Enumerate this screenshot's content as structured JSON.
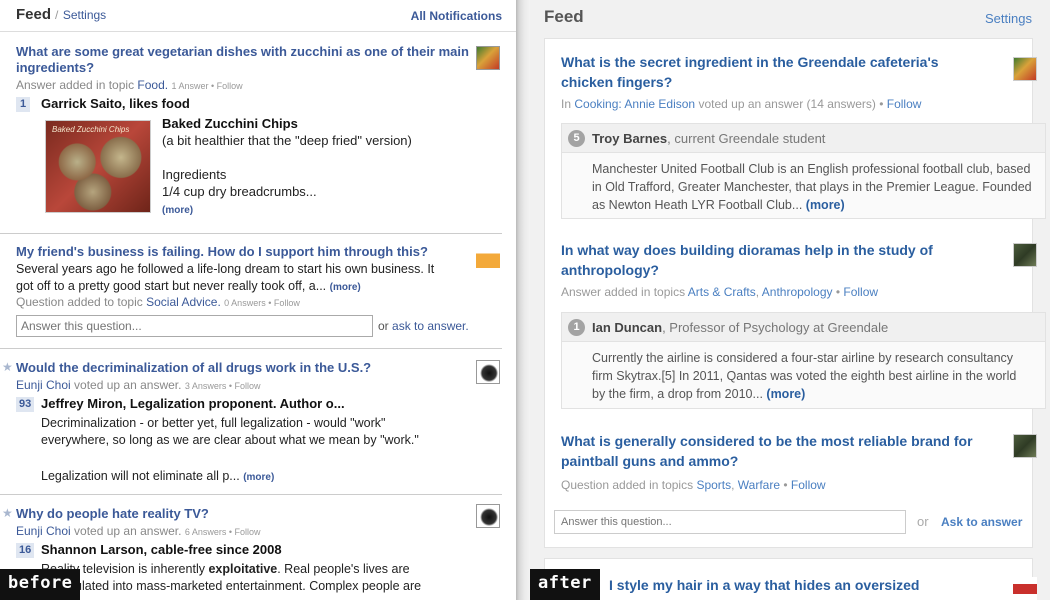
{
  "before": {
    "label": "before",
    "header": {
      "title": "Feed",
      "slash": "/",
      "settings": "Settings",
      "all_notifications": "All Notifications"
    },
    "items": [
      {
        "question": "What are some great vegetarian dishes with zucchini as one of their main ingredients?",
        "meta_prefix": "Answer added in topic",
        "topic": "Food.",
        "meta_small": "1 Answer • Follow",
        "count": "1",
        "answerer": "Garrick Saito, likes food",
        "image_caption": "Baked Zucchini Chips",
        "answer_title": "Baked Zucchini Chips",
        "answer_lines": [
          "(a bit healthier that the \"deep fried\" version)",
          "",
          "Ingredients",
          "1/4 cup dry breadcrumbs..."
        ],
        "more": "(more)"
      },
      {
        "question": "My friend's business is failing. How do I support him through this?",
        "body_lines": [
          "Several years ago he followed a life-long dream to start his own business. It",
          "got off to a pretty good start but never really took off, a..."
        ],
        "more": "(more)",
        "meta_prefix": "Question added to topic",
        "topic": "Social Advice.",
        "meta_small": "0 Answers • Follow",
        "input_placeholder": "Answer this question...",
        "or": "or",
        "ask": "ask to answer."
      },
      {
        "question": "Would the decriminalization of all drugs work in the U.S.?",
        "user": "Eunji Choi",
        "action": "voted up an answer.",
        "meta_small": "3 Answers • Follow",
        "count": "93",
        "answerer": "Jeffrey Miron, Legalization proponent. Author o...",
        "body_lines": [
          "Decriminalization - or better yet, full legalization - would \"work\"",
          "everywhere, so long as we are clear about what we mean by \"work.\"",
          "",
          "Legalization will not eliminate all p..."
        ],
        "more": "(more)"
      },
      {
        "question": "Why do people hate reality TV?",
        "user": "Eunji Choi",
        "action": "voted up an answer.",
        "meta_small": "6 Answers • Follow",
        "count": "16",
        "answerer": "Shannon Larson, cable-free since 2008",
        "body_pre": "Reality television is inherently ",
        "body_bold": "exploitative",
        "body_post": ". Real people's lives are",
        "body_line2": "manipulated into mass-marketed entertainment. Complex people are"
      }
    ]
  },
  "after": {
    "label": "after",
    "header": {
      "title": "Feed",
      "settings": "Settings"
    },
    "cards": [
      {
        "question": "What is the secret ingredient in the Greendale cafeteria's chicken fingers?",
        "meta_in": "In",
        "meta_link": "Cooking: Annie Edison",
        "meta_mid": "voted up an answer (14 answers) •",
        "follow": "Follow",
        "count": "5",
        "name": "Troy Barnes",
        "cred": ", current Greendale student",
        "body": "Manchester United Football Club is an English professional football club, based in Old Trafford, Greater Manchester, that plays in the Premier League. Founded as Newton Heath LYR Football Club...",
        "more": "(more)"
      },
      {
        "question": "In what way does building dioramas help in the study of anthropology?",
        "meta_prefix": "Answer added in topics",
        "topic1": "Arts & Crafts",
        "topic2": "Anthropology",
        "follow": "Follow",
        "count": "1",
        "name": "Ian Duncan",
        "cred": ", Professor of Psychology at Greendale",
        "body": "Currently the airline is considered a four-star airline by research consultancy firm Skytrax.[5] In 2011, Qantas was voted the eighth best airline in the world by the firm, a drop from 2010...",
        "more": "(more)"
      },
      {
        "question": "What is generally considered to be the most reliable brand for paintball guns and ammo?",
        "meta_prefix": "Question added in topics",
        "topic1": "Sports",
        "topic2": "Warfare",
        "follow": "Follow",
        "input_placeholder": "Answer this question...",
        "or": "or",
        "ask": "Ask to answer"
      },
      {
        "question": "I style my hair in a way that hides an oversized"
      }
    ]
  }
}
